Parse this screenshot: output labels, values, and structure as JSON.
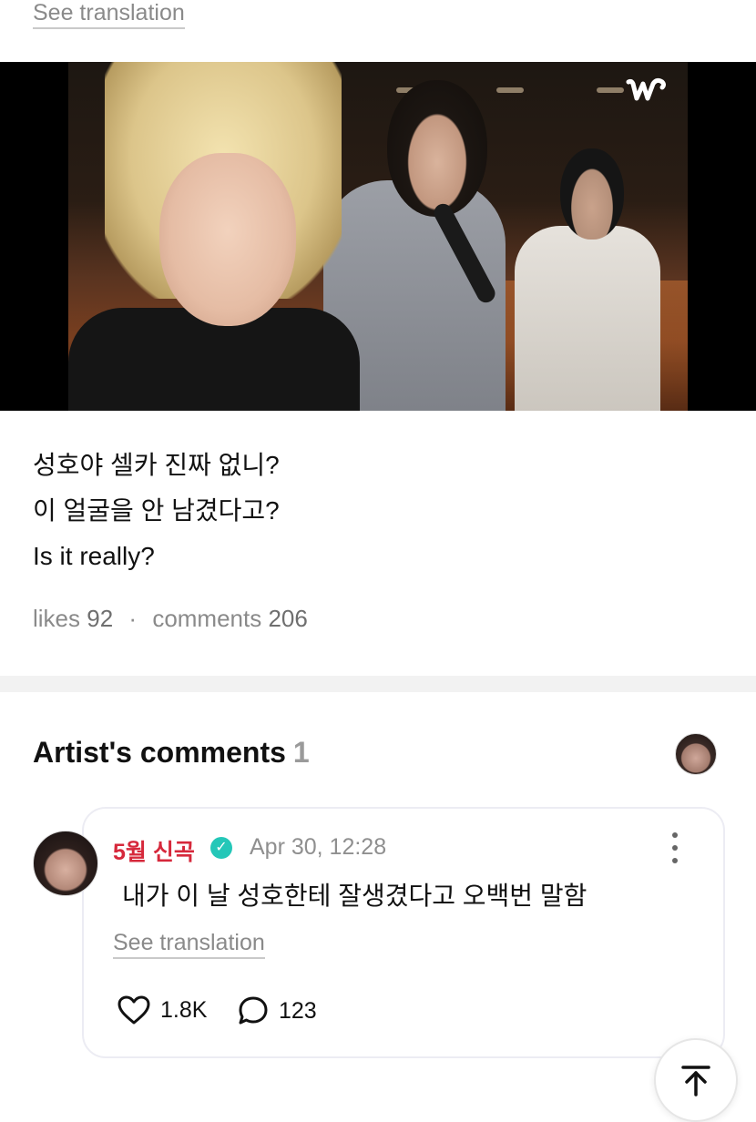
{
  "post": {
    "see_translation": "See translation",
    "caption_lines": [
      "성호야 셀카 진짜 없니?",
      "이 얼굴을 안 남겼다고?",
      "Is it really?"
    ],
    "likes_label": "likes",
    "likes_count": "92",
    "separator": "·",
    "comments_label": "comments",
    "comments_count": "206",
    "media_logo_icon": "weverse-w-logo-icon"
  },
  "artist_comments": {
    "title": "Artist's comments",
    "count": "1",
    "comment": {
      "author": "5월 신곡",
      "verified_icon": "verified-badge-icon",
      "verified_glyph": "✓",
      "time": "Apr 30, 12:28",
      "text": "내가 이 날 성호한테 잘생겼다고 오백번 말함",
      "see_translation": "See translation",
      "likes": "1.8K",
      "replies": "123"
    }
  },
  "icons": {
    "like": "heart-icon",
    "reply": "speech-bubble-icon",
    "more": "more-vertical-icon",
    "scroll_top": "arrow-up-to-top-icon"
  },
  "colors": {
    "author_name": "#d6283b",
    "verified_badge": "#24c7b8",
    "muted_text": "#8a8a8a"
  }
}
